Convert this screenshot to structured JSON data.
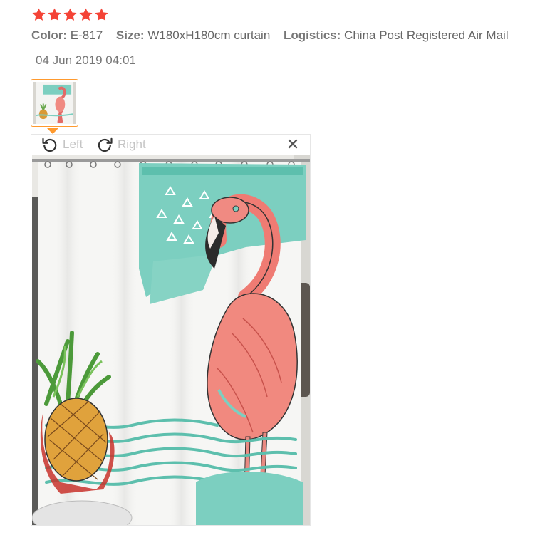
{
  "review": {
    "rating": 5,
    "rating_max": 5,
    "star_color": "#f44336",
    "attributes": [
      {
        "key": "Color:",
        "value": "E-817"
      },
      {
        "key": "Size:",
        "value": "W180xH180cm curtain"
      },
      {
        "key": "Logistics:",
        "value": "China Post Registered Air Mail"
      }
    ],
    "date": "04 Jun 2019 04:01"
  },
  "thumbnail": {
    "accent_color": "#ff9a2e"
  },
  "viewer": {
    "rotate_left_label": "Left",
    "rotate_right_label": "Right",
    "close_icon": "close-icon"
  }
}
